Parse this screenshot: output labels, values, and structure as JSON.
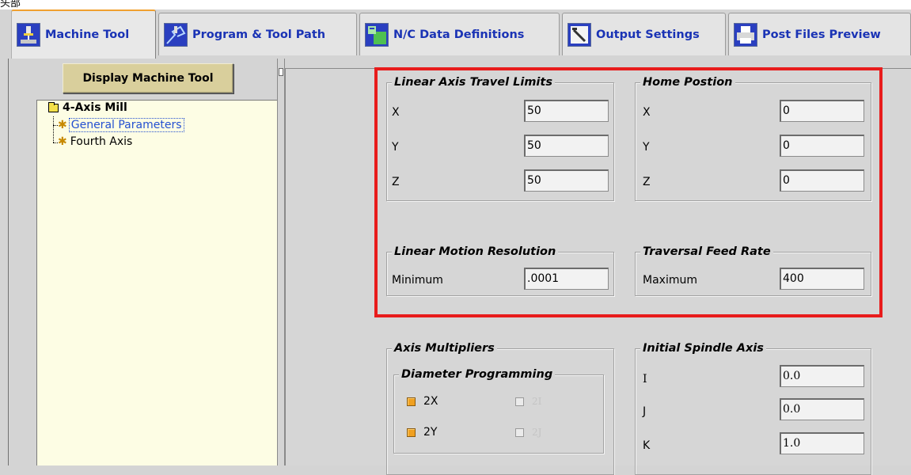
{
  "window": {
    "cut_off_text": "头部"
  },
  "tabs": [
    {
      "label": "Machine Tool",
      "icon": "machine-tool-icon",
      "active": true
    },
    {
      "label": "Program & Tool Path",
      "icon": "program-tool-path-icon",
      "active": false
    },
    {
      "label": "N/C Data Definitions",
      "icon": "nc-data-icon",
      "active": false
    },
    {
      "label": "Output Settings",
      "icon": "output-settings-icon",
      "active": false
    },
    {
      "label": "Post Files Preview",
      "icon": "printer-icon",
      "active": false
    }
  ],
  "left": {
    "display_button": "Display Machine Tool",
    "tree": {
      "root": "4-Axis Mill",
      "children": [
        {
          "label": "General Parameters",
          "selected": true
        },
        {
          "label": "Fourth Axis",
          "selected": false
        }
      ]
    }
  },
  "main": {
    "linear_limits": {
      "title": "Linear Axis Travel Limits",
      "rows": [
        {
          "label": "X",
          "value": "50"
        },
        {
          "label": "Y",
          "value": "50"
        },
        {
          "label": "Z",
          "value": "50"
        }
      ]
    },
    "home_position": {
      "title": "Home Postion",
      "rows": [
        {
          "label": "X",
          "value": "0"
        },
        {
          "label": "Y",
          "value": "0"
        },
        {
          "label": "Z",
          "value": "0"
        }
      ]
    },
    "linear_resolution": {
      "title": "Linear Motion Resolution",
      "label": "Minimum",
      "value": ".0001"
    },
    "traversal_feed": {
      "title": "Traversal Feed Rate",
      "label": "Maximum",
      "value": "400"
    },
    "axis_multipliers": {
      "title": "Axis Multipliers",
      "diameter_programming": {
        "title": "Diameter Programming",
        "options": [
          {
            "label": "2X",
            "checked": true,
            "enabled": true
          },
          {
            "label": "2I",
            "checked": false,
            "enabled": false
          },
          {
            "label": "2Y",
            "checked": true,
            "enabled": true
          },
          {
            "label": "2J",
            "checked": false,
            "enabled": false
          }
        ]
      }
    },
    "initial_spindle": {
      "title": "Initial Spindle Axis",
      "rows": [
        {
          "label": "I",
          "value": "0.0"
        },
        {
          "label": "J",
          "value": "0.0"
        },
        {
          "label": "K",
          "value": "1.0"
        }
      ]
    }
  },
  "colors": {
    "highlight": "#e81c1c",
    "tab_text": "#1a33b5",
    "active_tab_accent": "#f0a030",
    "tree_background": "#fdfde4",
    "checkbox_checked": "#f0a020"
  }
}
